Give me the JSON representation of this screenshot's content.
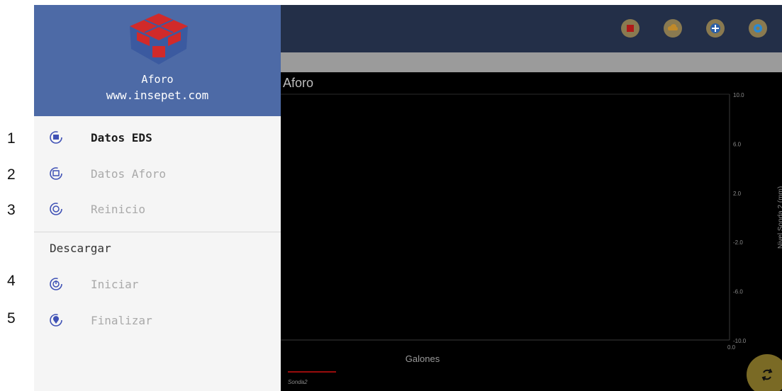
{
  "annotations": [
    "1",
    "2",
    "3",
    "4",
    "5"
  ],
  "drawer": {
    "title": "Aforo",
    "url": "www.insepet.com",
    "items": [
      {
        "label": "Datos EDS",
        "icon": "datos-eds-icon"
      },
      {
        "label": "Datos Aforo",
        "icon": "datos-aforo-icon"
      },
      {
        "label": "Reinicio",
        "icon": "reinicio-icon"
      }
    ],
    "section_title": "Descargar",
    "download_items": [
      {
        "label": "Iniciar",
        "icon": "power-icon"
      },
      {
        "label": "Finalizar",
        "icon": "location-pin-icon"
      }
    ]
  },
  "toolbar": {
    "buttons": [
      "book-icon",
      "cloud-icon",
      "add-icon",
      "settings-icon"
    ]
  },
  "chart_data": {
    "type": "line",
    "title": "Aforo",
    "xlabel": "Galones",
    "ylabel": "Nivel Sonda 2 (mm)",
    "y_ticks": [
      "10.0",
      "6.0",
      "2.0",
      "-2.0",
      "-6.0",
      "-10.0"
    ],
    "x_ticks": [
      "0.0"
    ],
    "ylim": [
      -10,
      10
    ],
    "series": [
      {
        "name": "Sonda2",
        "color": "#cc1111",
        "values": []
      }
    ],
    "legend": "bottom-left"
  },
  "colors": {
    "header": "#4d6aa6",
    "topbar": "#232f48",
    "accent": "#3f51b5"
  }
}
